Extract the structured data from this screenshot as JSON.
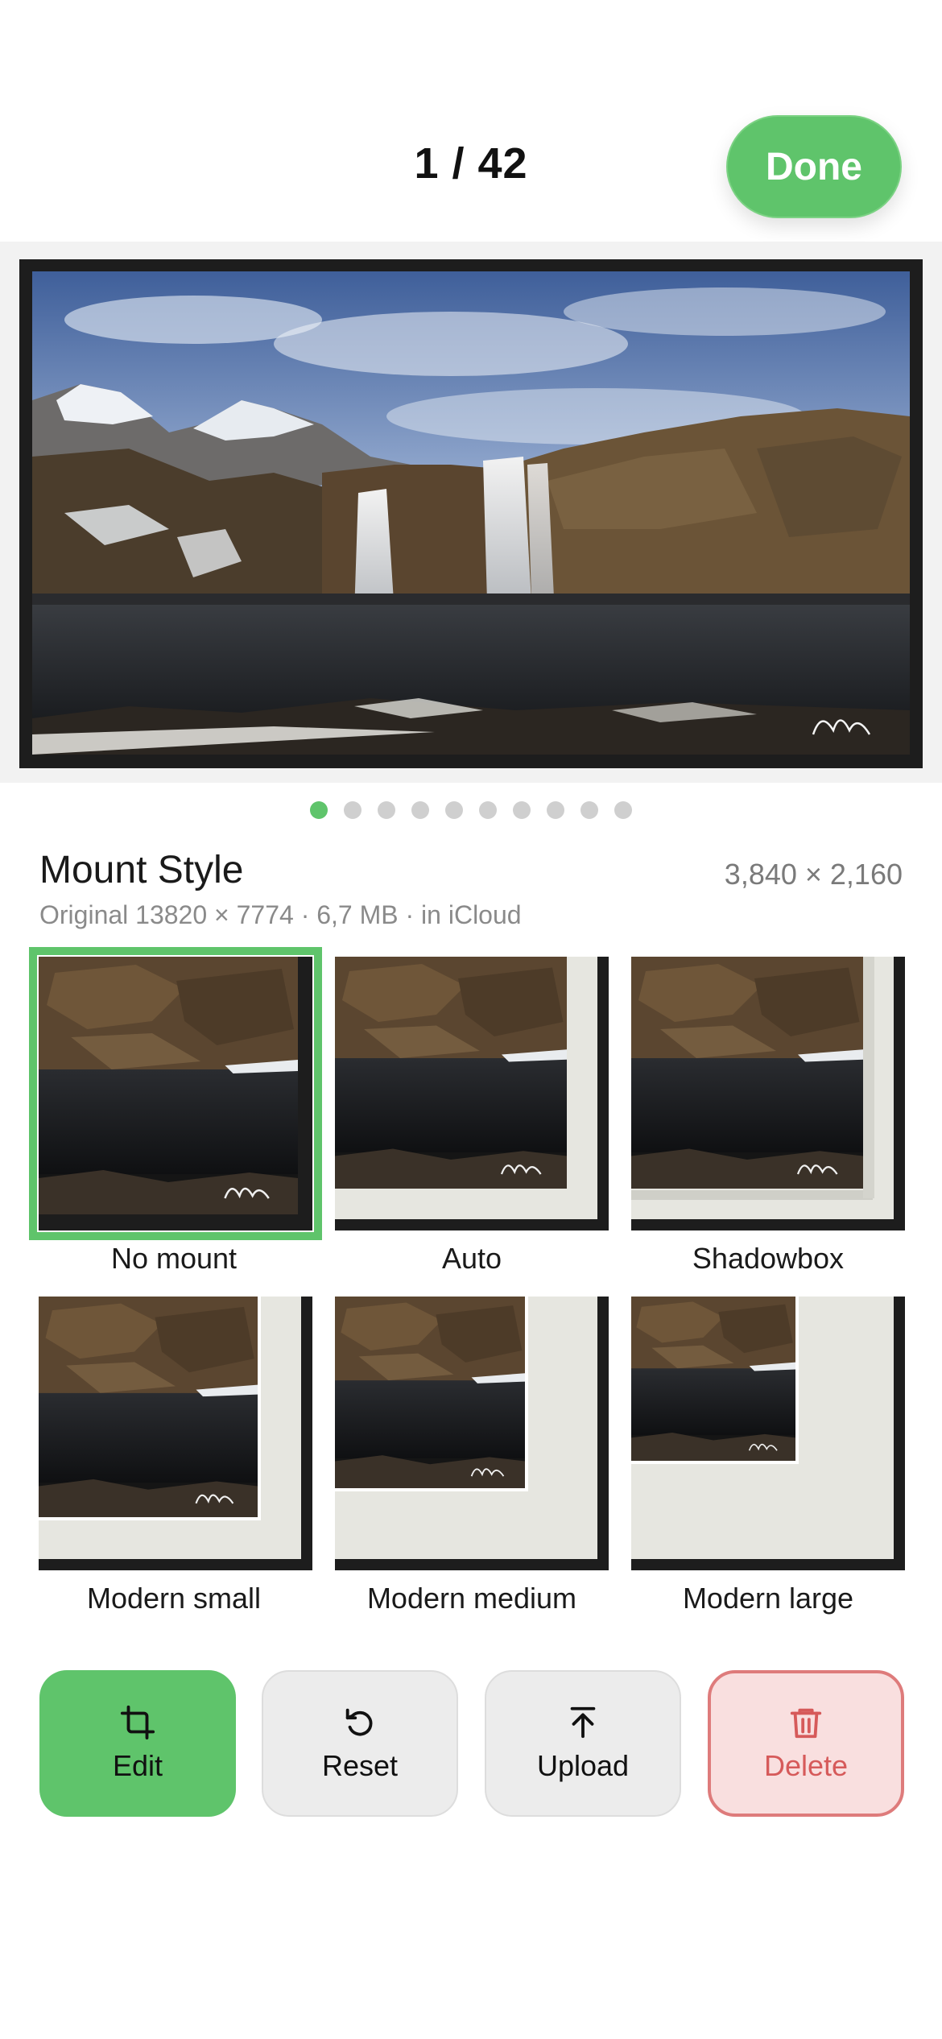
{
  "header": {
    "counter": "1 / 42",
    "done_label": "Done"
  },
  "photo": {
    "description_icon": "waterfall-photo",
    "current_page": 1,
    "page_dots": 10
  },
  "mount": {
    "title": "Mount Style",
    "resolution": "3,840 × 2,160",
    "meta": "Original 13820 × 7774 · 6,7 MB · in iCloud",
    "options": [
      {
        "label": "No mount",
        "selected": true
      },
      {
        "label": "Auto",
        "selected": false
      },
      {
        "label": "Shadowbox",
        "selected": false
      },
      {
        "label": "Modern small",
        "selected": false
      },
      {
        "label": "Modern medium",
        "selected": false
      },
      {
        "label": "Modern large",
        "selected": false
      }
    ]
  },
  "actions": {
    "edit": {
      "label": "Edit",
      "icon": "crop-icon"
    },
    "reset": {
      "label": "Reset",
      "icon": "rotate-ccw-icon"
    },
    "upload": {
      "label": "Upload",
      "icon": "upload-arrow-icon"
    },
    "delete": {
      "label": "Delete",
      "icon": "trash-icon"
    }
  },
  "colors": {
    "accent": "#5fc46b",
    "frame": "#1d1d1d",
    "mat": "#e6e6e0",
    "delete_border": "#de7b7b",
    "delete_bg": "#f9dfdf"
  }
}
